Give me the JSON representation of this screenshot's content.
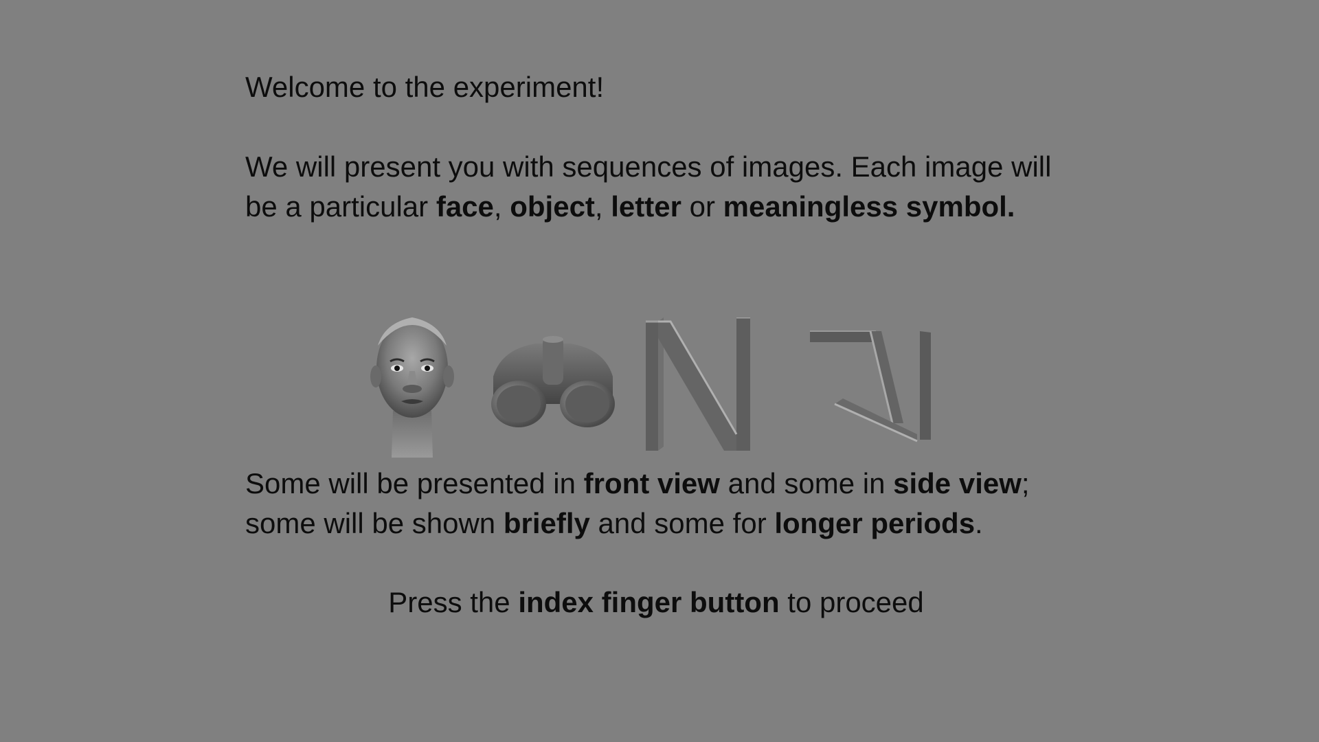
{
  "welcome": "Welcome to the experiment!",
  "intro": {
    "t1": "We will present you with sequences of images. Each image will be a particular ",
    "face": "face",
    "c1": ", ",
    "object": "object",
    "c2": ", ",
    "letter": "letter",
    "c3": " or ",
    "symbol": "meaningless symbol."
  },
  "stimuli": [
    {
      "icon": "face-image"
    },
    {
      "icon": "binoculars-image"
    },
    {
      "icon": "letter-n-image"
    },
    {
      "icon": "abstract-symbol-image"
    }
  ],
  "views": {
    "t1": "Some will be presented in ",
    "front": "front view",
    "t2": " and some in ",
    "side": "side view",
    "t3": "; some will be shown ",
    "briefly": "briefly",
    "t4": " and some for ",
    "longer": "longer periods",
    "t5": "."
  },
  "proceed": {
    "t1": "Press the ",
    "button": "index finger button",
    "t2": " to proceed"
  },
  "colors": {
    "background": "#808080",
    "text": "#0d0d0d"
  }
}
